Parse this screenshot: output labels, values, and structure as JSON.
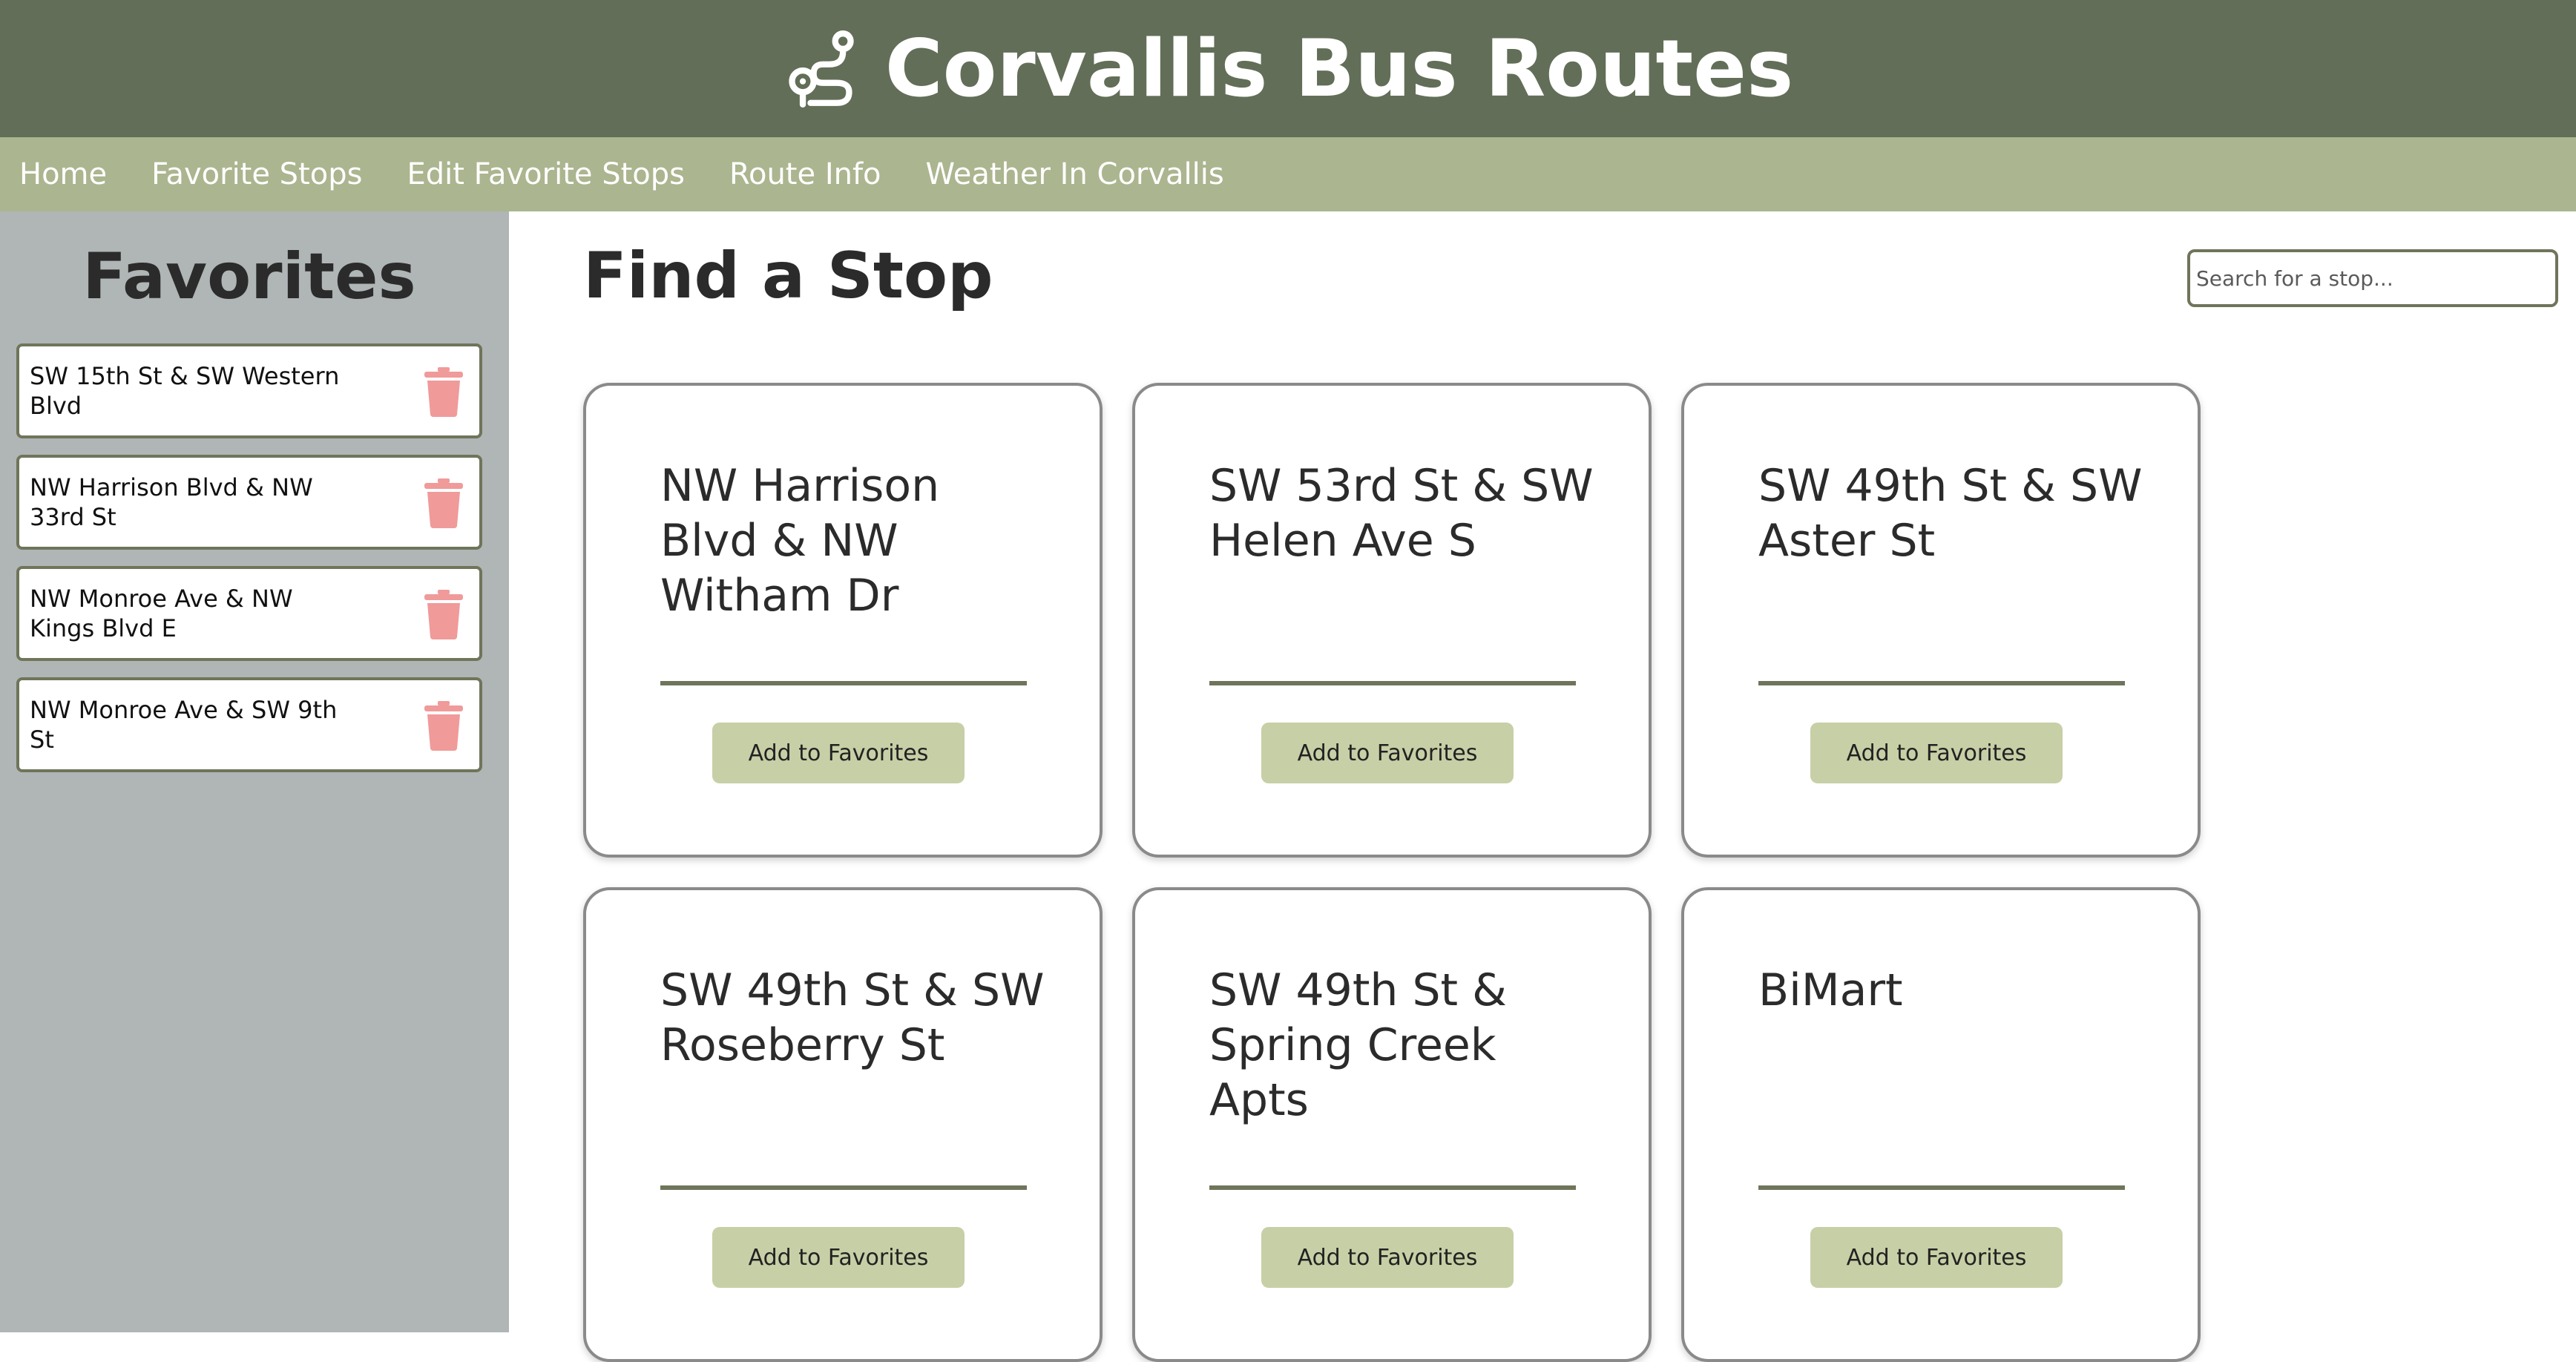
{
  "header": {
    "title": "Corvallis Bus Routes",
    "icon": "route-icon"
  },
  "nav": {
    "items": [
      "Home",
      "Favorite Stops",
      "Edit Favorite Stops",
      "Route Info",
      "Weather In Corvallis"
    ]
  },
  "sidebar": {
    "title": "Favorites",
    "items": [
      {
        "label": "SW 15th St & SW Western Blvd",
        "icon": "trash-icon"
      },
      {
        "label": "NW Harrison Blvd & NW 33rd St",
        "icon": "trash-icon"
      },
      {
        "label": "NW Monroe Ave & NW Kings Blvd E",
        "icon": "trash-icon"
      },
      {
        "label": "NW Monroe Ave & SW 9th St",
        "icon": "trash-icon"
      }
    ]
  },
  "main": {
    "title": "Find a Stop",
    "search_placeholder": "Search for a stop...",
    "cards": [
      {
        "name": "NW Harrison Blvd & NW Witham Dr",
        "button": "Add to Favorites"
      },
      {
        "name": "SW 53rd St & SW Helen Ave S",
        "button": "Add to Favorites"
      },
      {
        "name": "SW 49th St & SW Aster St",
        "button": "Add to Favorites"
      },
      {
        "name": "SW 49th St & SW Roseberry St",
        "button": "Add to Favorites"
      },
      {
        "name": "SW 49th St & Spring Creek Apts",
        "button": "Add to Favorites"
      },
      {
        "name": "BiMart",
        "button": "Add to Favorites"
      }
    ]
  },
  "colors": {
    "header_bg": "#626e57",
    "nav_bg": "#abb58f",
    "sidebar_bg": "#b0b5b6",
    "accent": "#6f755a",
    "button_bg": "#c7cfa6",
    "trash": "#f09a9a"
  }
}
